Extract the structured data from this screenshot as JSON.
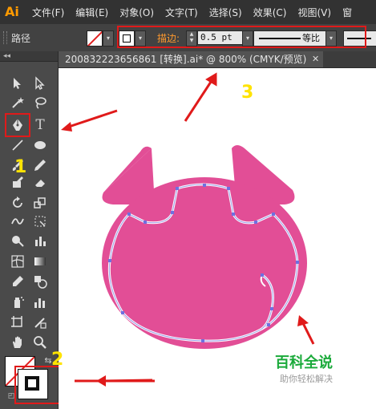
{
  "app": {
    "logo": "Ai",
    "brand_color": "#ff9a00"
  },
  "menubar": {
    "items": [
      "文件(F)",
      "编辑(E)",
      "对象(O)",
      "文字(T)",
      "选择(S)",
      "效果(C)",
      "视图(V)",
      "窗"
    ]
  },
  "controlbar": {
    "selection_label": "路径",
    "stroke_label": "描边:",
    "stroke_value": "0.5 pt",
    "profile_label": "等比"
  },
  "document": {
    "tab_title": "200832223656861 [转换].ai* @ 800% (CMYK/预览)",
    "close_glyph": "✕"
  },
  "toolbox": {
    "collapse_glyph": "◂◂"
  },
  "annotations": {
    "label_1": "1",
    "label_2": "2",
    "label_3": "3",
    "arrow_color": "#e01a1a",
    "highlight_color": "#e01a1a",
    "number_color": "#ffe300"
  },
  "artwork": {
    "fill_color": "#e24e96",
    "path_color": "#b9b9f0"
  },
  "watermark": {
    "main": "百科全说",
    "sub": "助你轻松解决"
  }
}
